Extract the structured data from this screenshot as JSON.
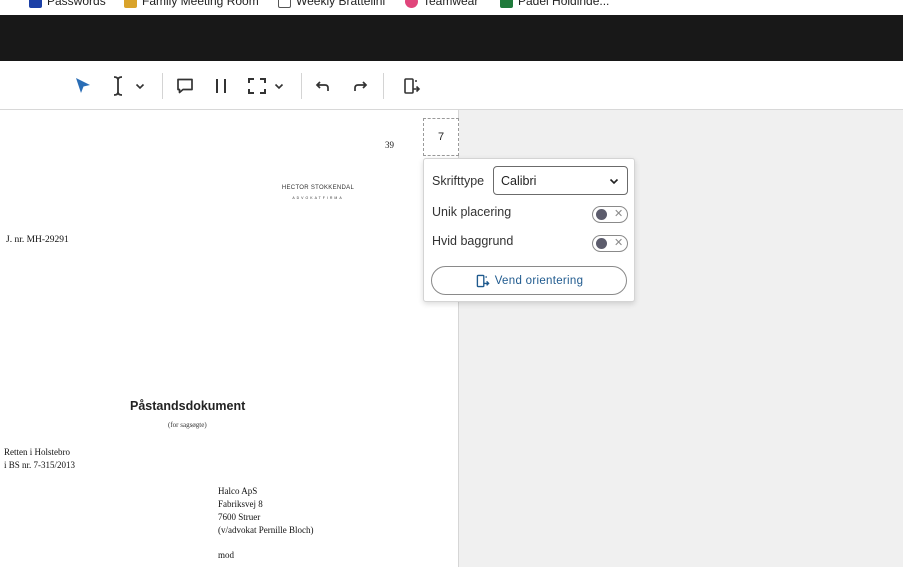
{
  "bookmarks": [
    {
      "label": "Passwords",
      "icon": "passwords-icon",
      "color": "#1b3fa6"
    },
    {
      "label": "Family Meeting Room",
      "icon": "meeting-icon",
      "color": "#d9a32b"
    },
    {
      "label": "Weekly Brattelini",
      "icon": "document-icon",
      "color": "#555555"
    },
    {
      "label": "Teamwear",
      "icon": "teamwear-icon",
      "color": "#e0457b"
    },
    {
      "label": "Padel Holdinde...",
      "icon": "spreadsheet-icon",
      "color": "#1f7a3a"
    }
  ],
  "toolbar": {
    "tools": [
      "select-arrow-icon",
      "text-cursor-icon",
      "chevron-down-icon",
      "comment-icon",
      "columns-icon",
      "crop-icon",
      "chevron-down-icon",
      "undo-icon",
      "redo-icon",
      "rotate-page-icon"
    ],
    "accent": "#2a6db5"
  },
  "document": {
    "page_number": "39",
    "letterhead_name": "HECTOR  STOKKENDAL",
    "letterhead_sub": "ADVOKATFIRMA",
    "journal_number": "J. nr. MH-29291",
    "title": "Påstandsdokument",
    "subtitle": "(for sagsøgte)",
    "court_lines": [
      "Retten i Holstebro",
      "i BS nr. 7-315/2013"
    ],
    "party_lines": [
      "Halco ApS",
      "Fabriksvej 8",
      "7600 Struer",
      "(v/advokat Pernille Bloch)"
    ],
    "mod": "mod"
  },
  "stamp": {
    "value": "7"
  },
  "popup": {
    "font_label": "Skrifttype",
    "font_value": "Calibri",
    "unique_label": "Unik placering",
    "unique_on": false,
    "white_bg_label": "Hvid baggrund",
    "white_bg_on": false,
    "rotate_button": "Vend orientering"
  }
}
